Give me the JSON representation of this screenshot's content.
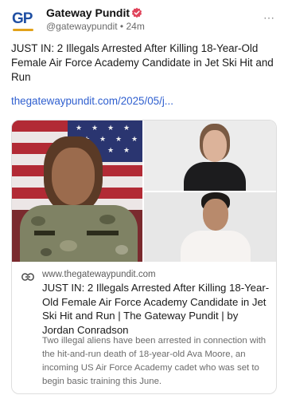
{
  "account": {
    "name": "Gateway Pundit",
    "handle": "@gatewaypundit",
    "separator": "•",
    "time": "24m",
    "avatar_text": "GP",
    "avatar_icon": "gateway-pundit-logo",
    "verified_icon": "verified-badge-icon",
    "verified_color": "#e0445b",
    "more_icon": "more-options-icon"
  },
  "post": {
    "text": "JUST IN: 2 Illegals Arrested After Killing 18-Year-Old Female Air Force Academy Candidate in Jet Ski Hit and Run",
    "link_text": "thegatewaypundit.com/2025/05/j...",
    "link_color": "#2f5fcf"
  },
  "card": {
    "link_icon": "link-icon",
    "domain": "www.thegatewaypundit.com",
    "title": "JUST IN: 2 Illegals Arrested After Killing 18-Year-Old Female Air Force Academy Candidate in Jet Ski Hit and Run | The Gateway Pundit | by Jordan Conradson",
    "description": "Two illegal aliens have been arrested in connection with the hit-and-run death of 18-year-old Ava Moore, an incoming US Air Force Academy cadet who was set to begin basic training this June."
  }
}
